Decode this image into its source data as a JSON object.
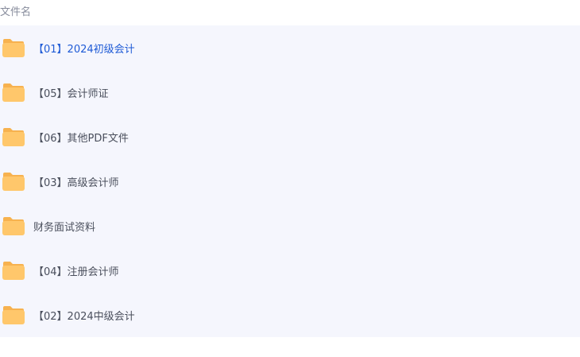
{
  "header": {
    "filename_label": "文件名"
  },
  "files": [
    {
      "name": "【01】2024初级会计",
      "active": true
    },
    {
      "name": "【05】会计师证",
      "active": false
    },
    {
      "name": "【06】其他PDF文件",
      "active": false
    },
    {
      "name": "【03】高级会计师",
      "active": false
    },
    {
      "name": "财务面试资料",
      "active": false
    },
    {
      "name": "【04】注册会计师",
      "active": false
    },
    {
      "name": "【02】2024中级会计",
      "active": false
    }
  ],
  "colors": {
    "list_background": "#f5f6fd",
    "folder_body": "#ffc76b",
    "folder_tab": "#f7b24f",
    "active_text": "#1f5bd6",
    "text": "#4a4f5c",
    "header_text": "#878c9c"
  },
  "icons": {
    "folder": "folder-icon"
  }
}
